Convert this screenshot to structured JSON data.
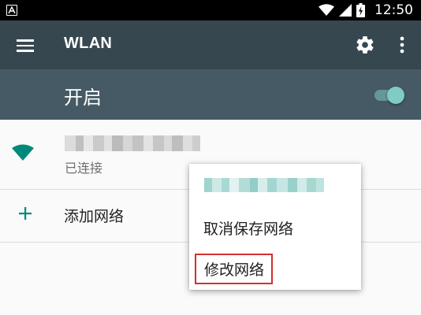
{
  "status_bar": {
    "time": "12:50"
  },
  "app_bar": {
    "title": "WLAN",
    "background": "#37474f",
    "icons": [
      "menu-icon",
      "gear-icon",
      "overflow-icon"
    ]
  },
  "wlan_switch": {
    "label": "开启",
    "state": "on",
    "accent": "#80cbc4",
    "background": "#455a64"
  },
  "network_list": {
    "connected_network": {
      "ssid_visibility": "pixelated",
      "status": "已连接",
      "icon": "wifi-full-icon",
      "icon_color": "#00897b"
    },
    "add_network": {
      "label": "添加网络",
      "icon": "plus-icon",
      "icon_color": "#00897b"
    }
  },
  "context_menu": {
    "title_visibility": "pixelated",
    "items": [
      {
        "label": "取消保存网络",
        "highlighted": false
      },
      {
        "label": "修改网络",
        "highlighted": true,
        "highlight_color": "#d32f2f"
      }
    ]
  }
}
